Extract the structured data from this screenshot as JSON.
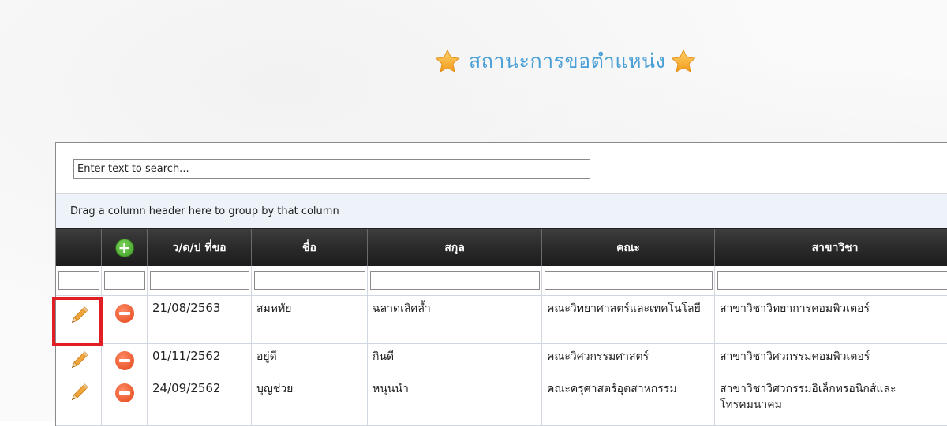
{
  "page": {
    "title": "สถานะการขอตำแหน่ง",
    "accent_color": "#4a9fd6",
    "star_color": "#f6a52a"
  },
  "grid": {
    "search_placeholder": "Enter text to search...",
    "group_panel_text": "Drag a column header here to group by that column",
    "columns": [
      {
        "key": "edit",
        "label": ""
      },
      {
        "key": "add",
        "label": "",
        "icon": "plus-circle-icon"
      },
      {
        "key": "date",
        "label": "ว/ด/ป ที่ขอ"
      },
      {
        "key": "first_name",
        "label": "ชื่อ"
      },
      {
        "key": "last_name",
        "label": "สกุล"
      },
      {
        "key": "faculty",
        "label": "คณะ"
      },
      {
        "key": "department",
        "label": "สาขาวิชา"
      }
    ],
    "rows": [
      {
        "date": "21/08/2563",
        "first_name": "สมหทัย",
        "last_name": "ฉลาดเลิศล้ำ",
        "faculty": "คณะวิทยาศาสตร์และเทคโนโลยี",
        "department": "สาขาวิชาวิทยาการคอมพิวเตอร์"
      },
      {
        "date": "01/11/2562",
        "first_name": "อยู่ดี",
        "last_name": "กินดี",
        "faculty": "คณะวิศวกรรมศาสตร์",
        "department": "สาขาวิชาวิศวกรรมคอมพิวเตอร์"
      },
      {
        "date": "24/09/2562",
        "first_name": "บุญช่วย",
        "last_name": "หนุนนำ",
        "faculty": "คณะครุศาสตร์อุตสาหกรรม",
        "department": "สาขาวิชาวิศวกรรมอิเล็กทรอนิกส์และโทรคมนาคม"
      }
    ],
    "highlight_color": "#e01e24"
  }
}
